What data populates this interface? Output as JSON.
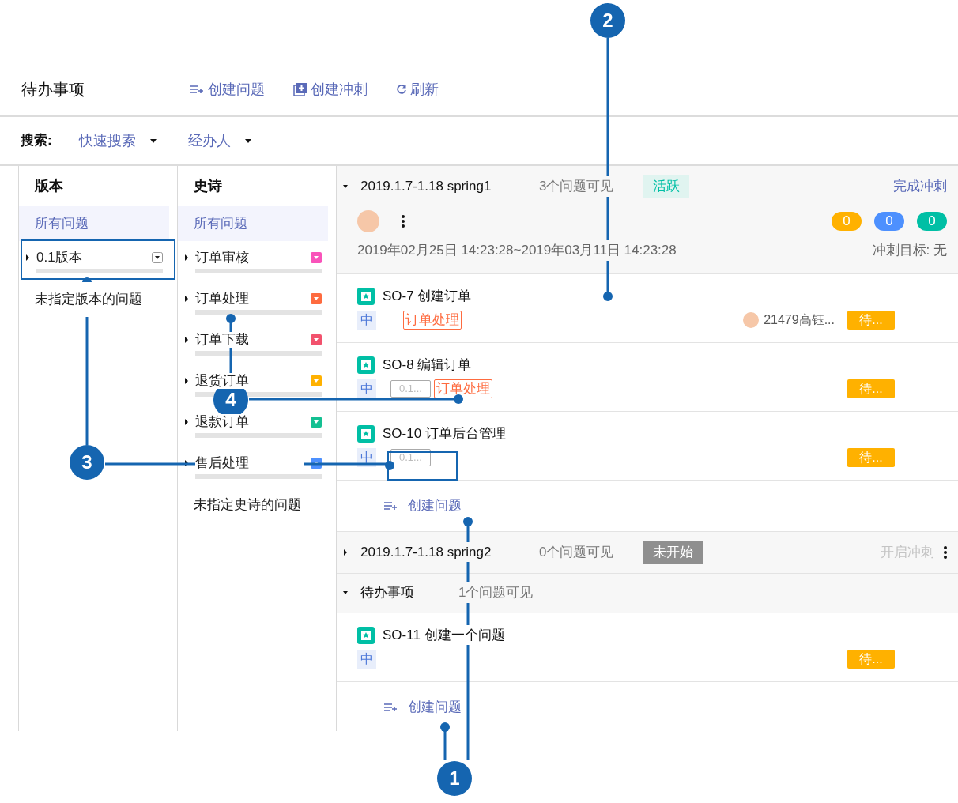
{
  "header": {
    "title": "待办事项",
    "actions": [
      {
        "kind": "create-issue",
        "label": "创建问题"
      },
      {
        "kind": "create-sprint",
        "label": "创建冲刺"
      },
      {
        "kind": "refresh",
        "label": "刷新"
      }
    ]
  },
  "search": {
    "label": "搜索:",
    "filters": [
      {
        "label": "快速搜索"
      },
      {
        "label": "经办人"
      }
    ]
  },
  "versions": {
    "title": "版本",
    "items": [
      {
        "kind": "all",
        "label": "所有问题",
        "selected": true
      },
      {
        "kind": "item",
        "label": "0.1版本",
        "selected": false,
        "expanded": false
      },
      {
        "kind": "none",
        "label": "未指定版本的问题",
        "selected": false
      }
    ]
  },
  "epics": {
    "title": "史诗",
    "items": [
      {
        "kind": "all",
        "label": "所有问题",
        "selected": true
      },
      {
        "kind": "item",
        "label": "订单审核",
        "selected": false,
        "expanded": false,
        "color": "#f953ba"
      },
      {
        "kind": "item",
        "label": "订单处理",
        "selected": false,
        "expanded": false,
        "color": "#fe6b3f"
      },
      {
        "kind": "item",
        "label": "订单下载",
        "selected": false,
        "expanded": false,
        "color": "#f2526d"
      },
      {
        "kind": "item",
        "label": "退货订单",
        "selected": false,
        "expanded": false,
        "color": "#ffb100"
      },
      {
        "kind": "item",
        "label": "退款订单",
        "selected": false,
        "expanded": false,
        "color": "#14c092"
      },
      {
        "kind": "item",
        "label": "售后处理",
        "selected": false,
        "expanded": false,
        "color": "#4d90fe"
      },
      {
        "kind": "none",
        "label": "未指定史诗的问题",
        "selected": false
      }
    ]
  },
  "sprints": [
    {
      "name": "2019.1.7-1.18 spring1",
      "count": "3个问题可见",
      "expanded": true,
      "status": {
        "kind": "active",
        "label": "活跃"
      },
      "action": {
        "label": "完成冲刺",
        "disabled": false
      },
      "counters": [
        {
          "value": "0",
          "color": "#ffb100"
        },
        {
          "value": "0",
          "color": "#4d90fe"
        },
        {
          "value": "0",
          "color": "#00bfa5"
        }
      ],
      "dates": "2019年02月25日 14:23:28~2019年03月11日 14:23:28",
      "goal": "冲刺目标: 无",
      "issues": [
        {
          "title": "SO-7 创建订单",
          "priority": "中",
          "epic": "订单处理",
          "assignee": "21479高钰...",
          "status": "待..."
        },
        {
          "title": "SO-8 编辑订单",
          "priority": "中",
          "version": "0.1...",
          "epic": "订单处理",
          "status": "待..."
        },
        {
          "title": "SO-10 订单后台管理",
          "priority": "中",
          "version": "0.1...",
          "status": "待..."
        }
      ],
      "create_label": "创建问题"
    },
    {
      "name": "2019.1.7-1.18 spring2",
      "count": "0个问题可见",
      "expanded": false,
      "status": {
        "kind": "planned",
        "label": "未开始"
      },
      "action": {
        "label": "开启冲刺",
        "disabled": true
      }
    }
  ],
  "backlog": {
    "name": "待办事项",
    "count": "1个问题可见",
    "expanded": true,
    "issues": [
      {
        "title": "SO-11 创建一个问题",
        "priority": "中",
        "status": "待..."
      }
    ],
    "create_label": "创建问题"
  },
  "callouts": [
    {
      "number": "1"
    },
    {
      "number": "2"
    },
    {
      "number": "3"
    },
    {
      "number": "4"
    }
  ]
}
